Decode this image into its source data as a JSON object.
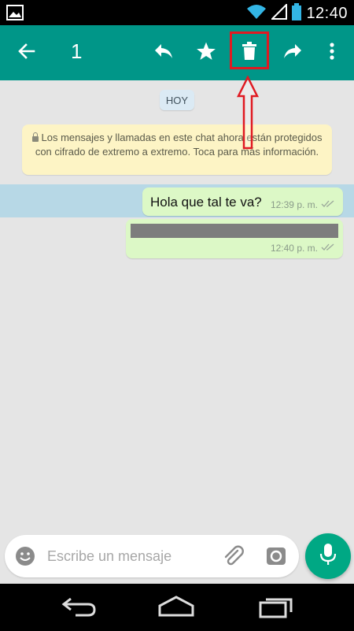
{
  "status_bar": {
    "time": "12:40",
    "icons": [
      "image-icon",
      "wifi-icon",
      "signal-icon",
      "battery-icon"
    ]
  },
  "app_bar": {
    "selected_count": "1",
    "actions": [
      "back-arrow-icon",
      "reply-icon",
      "star-icon",
      "delete-icon",
      "forward-icon",
      "more-vert-icon"
    ],
    "highlight_color": "#e01a22",
    "accent_color": "#009688"
  },
  "chat": {
    "day_label": "HOY",
    "encryption_notice": "Los mensajes y llamadas en este chat ahora están protegidos con cifrado de extremo a extremo. Toca para más información.",
    "messages": [
      {
        "text": "Hola que tal te va?",
        "time": "12:39 p. m.",
        "selected": true
      },
      {
        "text": "",
        "time": "12:40 p. m.",
        "redacted": true
      }
    ]
  },
  "composer": {
    "placeholder": "Escribe un mensaje",
    "icons": [
      "emoji-icon",
      "attach-icon",
      "camera-icon",
      "mic-icon"
    ]
  },
  "nav_bar": {
    "icons": [
      "back-nav-icon",
      "home-nav-icon",
      "recents-nav-icon"
    ]
  }
}
